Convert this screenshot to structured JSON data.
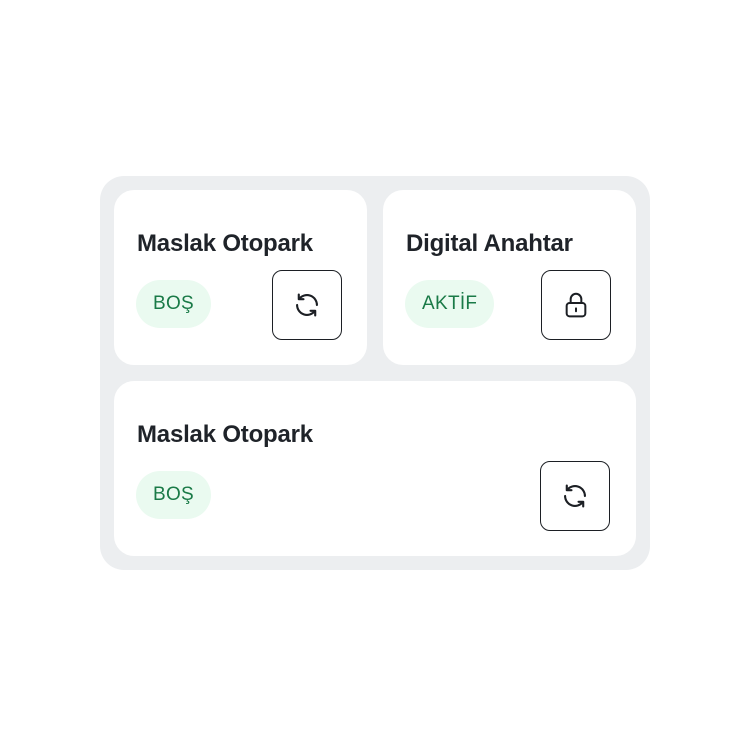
{
  "cards": [
    {
      "title": "Maslak Otopark",
      "status": "BOŞ",
      "action_icon": "refresh-icon"
    },
    {
      "title": "Digital Anahtar",
      "status": "AKTİF",
      "action_icon": "lock-icon"
    },
    {
      "title": "Maslak Otopark",
      "status": "BOŞ",
      "action_icon": "refresh-icon"
    }
  ],
  "colors": {
    "panel_background": "#eceef0",
    "card_background": "#ffffff",
    "title_text": "#1f2329",
    "badge_background": "#eafaf0",
    "badge_text": "#1a7a47",
    "button_border": "#1c1f24"
  }
}
